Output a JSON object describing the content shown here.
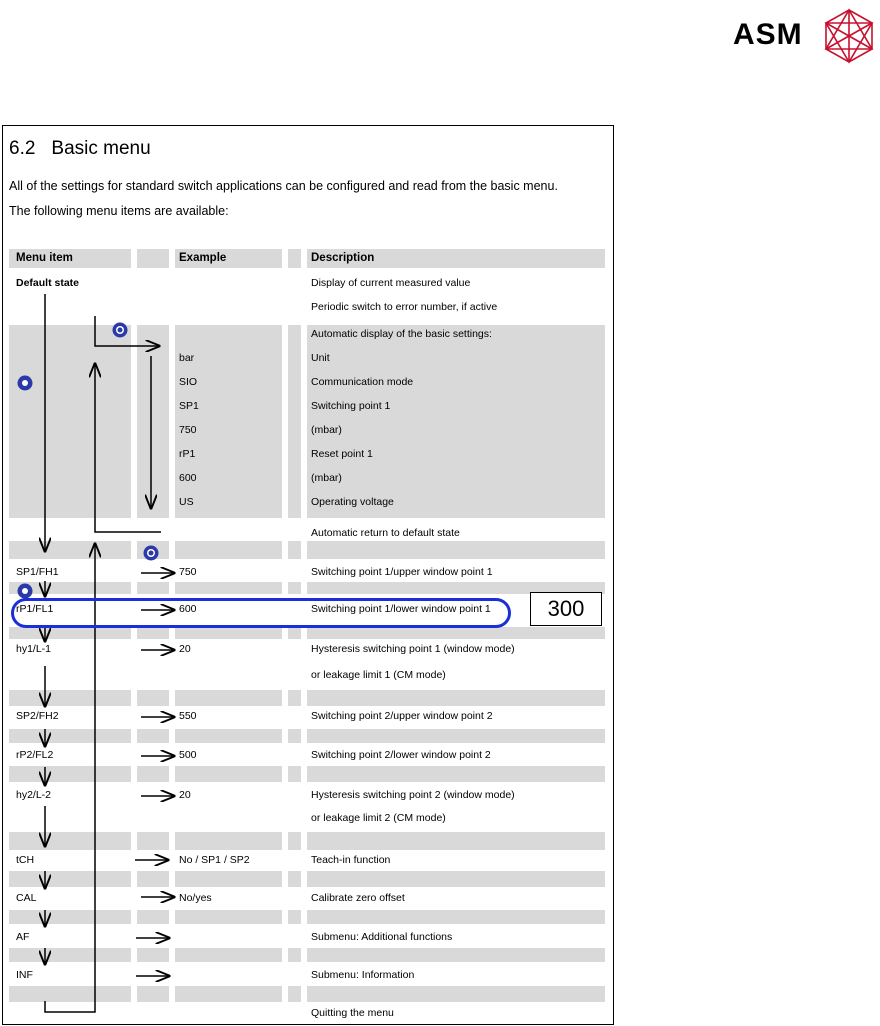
{
  "brand": {
    "name": "ASM"
  },
  "section": {
    "number": "6.2",
    "title": "Basic menu"
  },
  "intro": [
    "All of the settings for standard switch applications can be configured and read from the basic menu.",
    "The following menu items are available:"
  ],
  "columns": {
    "menu_item": "Menu item",
    "example": "Example",
    "description": "Description"
  },
  "default_state": {
    "label": "Default state",
    "desc1": "Display of current measured value",
    "desc2": "Periodic switch to error number, if active"
  },
  "auto_display": {
    "title": "Automatic display of the basic settings:",
    "rows": [
      {
        "example": "bar",
        "desc": "Unit"
      },
      {
        "example": "SIO",
        "desc": "Communication mode"
      },
      {
        "example": "SP1",
        "desc": "Switching point 1"
      },
      {
        "example": "750",
        "desc": "(mbar)"
      },
      {
        "example": "rP1",
        "desc": "Reset point 1"
      },
      {
        "example": "600",
        "desc": "(mbar)"
      },
      {
        "example": "US",
        "desc": "Operating voltage"
      }
    ],
    "return_text": "Automatic return to default state"
  },
  "items": [
    {
      "name": "SP1/FH1",
      "example": "750",
      "desc": "Switching point 1/upper window point 1"
    },
    {
      "name": "rP1/FL1",
      "example": "600",
      "desc": "Switching point 1/lower window point 1"
    },
    {
      "name": "hy1/L-1",
      "example": "20",
      "desc": "Hysteresis switching point 1 (window mode)",
      "desc2": "or leakage limit 1 (CM mode)"
    },
    {
      "name": "SP2/FH2",
      "example": "550",
      "desc": "Switching point 2/upper window point 2"
    },
    {
      "name": "rP2/FL2",
      "example": "500",
      "desc": "Switching point 2/lower window point 2"
    },
    {
      "name": "hy2/L-2",
      "example": "20",
      "desc": "Hysteresis switching point 2 (window mode)",
      "desc2": "or leakage limit 2 (CM mode)"
    },
    {
      "name": "tCH",
      "example": "No / SP1 / SP2",
      "desc": "Teach-in function"
    },
    {
      "name": "CAL",
      "example": "No/yes",
      "desc": "Calibrate zero offset"
    },
    {
      "name": "AF",
      "example": "",
      "desc": "Submenu: Additional functions"
    },
    {
      "name": "INF",
      "example": "",
      "desc": "Submenu: Information"
    }
  ],
  "quit_text": "Quitting the menu",
  "annotation": {
    "value": "300"
  },
  "colors": {
    "row_shade": "#d9d9d9",
    "callout": "#1a2fd8",
    "knob": "#2b3aa8"
  }
}
